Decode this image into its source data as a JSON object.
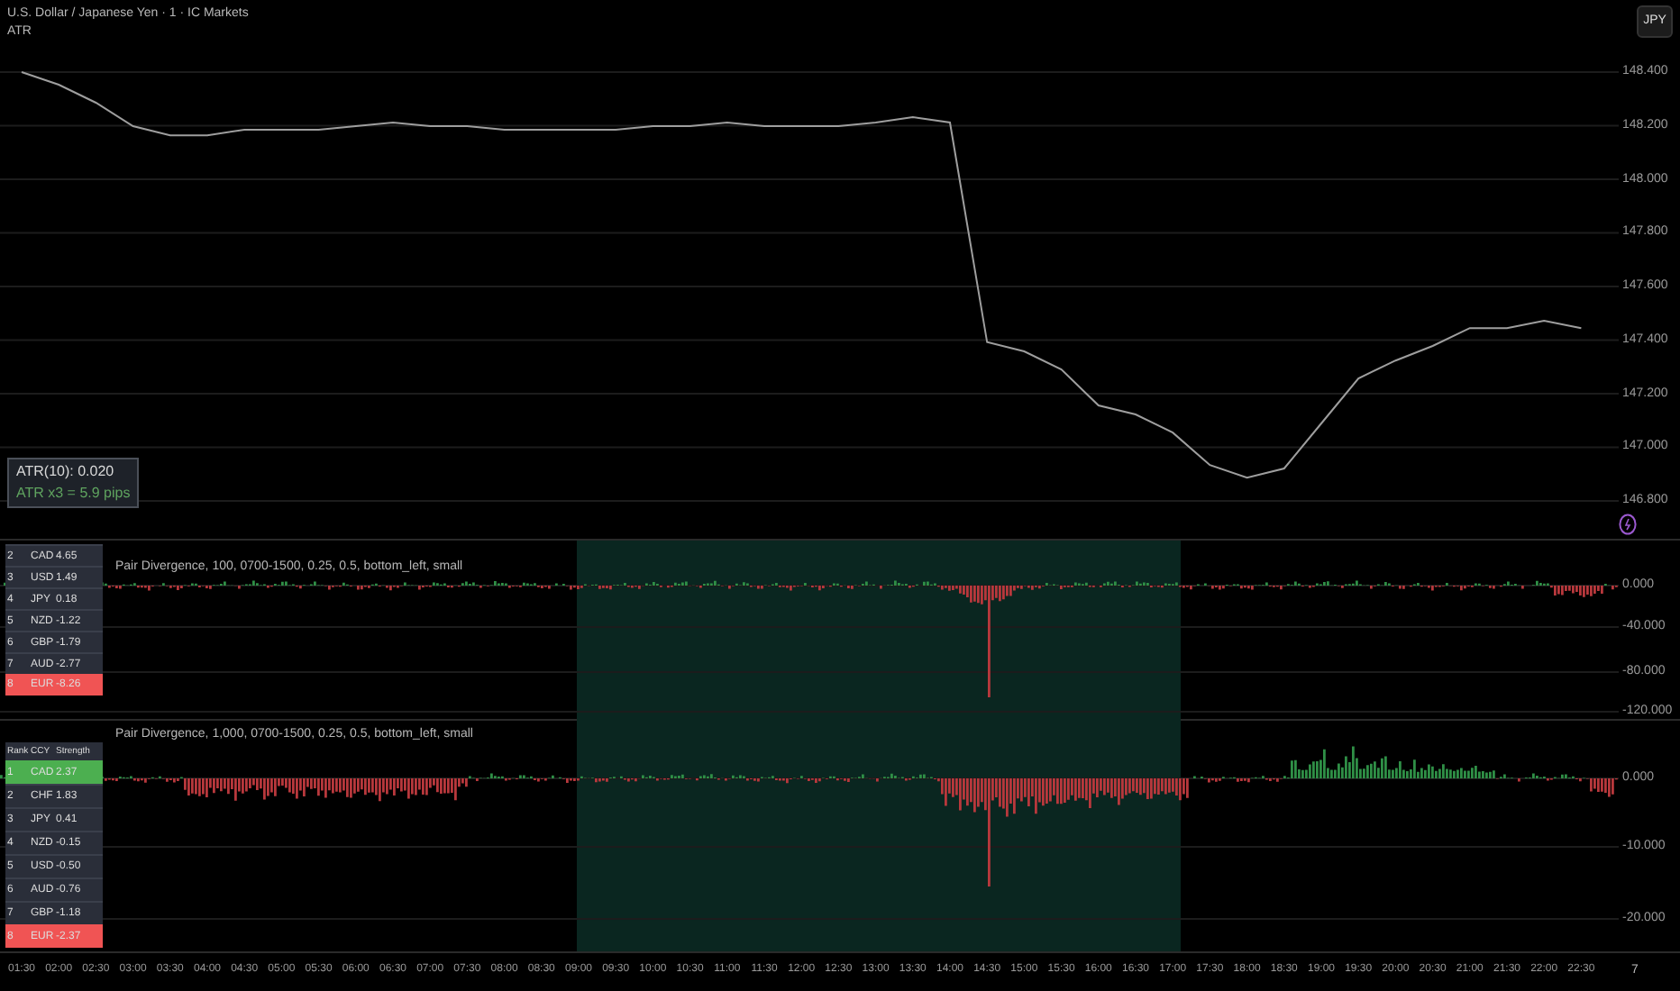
{
  "header": {
    "symbol_title": "U.S. Dollar / Japanese Yen · 1 · IC Markets",
    "indicator_label": "ATR"
  },
  "currency_button": {
    "label": "JPY"
  },
  "atr_box": {
    "line_1": "ATR(10): 0.020",
    "line_2": "ATR x3 = 5.9 pips"
  },
  "time_axis": [
    "01:30",
    "02:00",
    "02:30",
    "03:00",
    "03:30",
    "04:00",
    "04:30",
    "05:00",
    "05:30",
    "06:00",
    "06:30",
    "07:00",
    "07:30",
    "08:00",
    "08:30",
    "09:00",
    "09:30",
    "10:00",
    "10:30",
    "11:00",
    "11:30",
    "12:00",
    "12:30",
    "13:00",
    "13:30",
    "14:00",
    "14:30",
    "15:00",
    "15:30",
    "16:00",
    "16:30",
    "17:00",
    "17:30",
    "18:00",
    "18:30",
    "19:00",
    "19:30",
    "20:00",
    "20:30",
    "21:00",
    "21:30",
    "22:00",
    "22:30"
  ],
  "price_chart": {
    "chart_data": {
      "type": "line",
      "series": [
        {
          "color": "#9e9e9e",
          "values": [
            148.4,
            148.353,
            148.286,
            148.198,
            148.164,
            148.164,
            148.185,
            148.185,
            148.185,
            148.198,
            148.212,
            148.198,
            148.198,
            148.185,
            148.185,
            148.185,
            148.185,
            148.198,
            148.198,
            148.212,
            148.198,
            148.198,
            148.198,
            148.212,
            148.232,
            148.212,
            147.392,
            147.358,
            147.291,
            147.156,
            147.123,
            147.055,
            146.934,
            146.887,
            146.921,
            147.089,
            147.257,
            147.324,
            147.378,
            147.445,
            147.445,
            147.472,
            147.445
          ]
        }
      ],
      "ylim": [
        146.8,
        148.4
      ],
      "grid": true,
      "yticks": [
        {
          "value": 148.4,
          "label": "148.400"
        },
        {
          "value": 148.2,
          "label": "148.200"
        },
        {
          "value": 148.0,
          "label": "148.000"
        },
        {
          "value": 147.8,
          "label": "147.800"
        },
        {
          "value": 147.6,
          "label": "147.600"
        },
        {
          "value": 147.4,
          "label": "147.400"
        },
        {
          "value": 147.2,
          "label": "147.200"
        },
        {
          "value": 147.0,
          "label": "147.000"
        },
        {
          "value": 146.8,
          "label": "146.800"
        }
      ]
    }
  },
  "date_marker": "7",
  "panes": [
    {
      "legend": "Pair Divergence, 100, 0700-1500, 0.25, 0.5, bottom_left, small",
      "axis_labels": [
        "0.000",
        "-40.000",
        "-80.000",
        "-120.000"
      ],
      "table": {
        "rows": [
          {
            "rank": "2",
            "ccy": "CAD",
            "strength": "4.65"
          },
          {
            "rank": "3",
            "ccy": "USD",
            "strength": "1.49"
          },
          {
            "rank": "4",
            "ccy": "JPY",
            "strength": "0.18"
          },
          {
            "rank": "5",
            "ccy": "NZD",
            "strength": "-1.22"
          },
          {
            "rank": "6",
            "ccy": "GBP",
            "strength": "-1.79"
          },
          {
            "rank": "7",
            "ccy": "AUD",
            "strength": "-2.77"
          },
          {
            "rank": "8",
            "ccy": "EUR",
            "strength": "-8.26",
            "color": "#f05454"
          }
        ]
      }
    },
    {
      "legend": "Pair Divergence, 1,000, 0700-1500, 0.25, 0.5, bottom_left, small",
      "axis_labels": [
        "0.000",
        "-10.000",
        "-20.000"
      ],
      "table": {
        "columns": [
          "Rank",
          "CCY",
          "Strength"
        ],
        "rows": [
          {
            "rank": "1",
            "ccy": "CAD",
            "strength": "2.37",
            "color": "#4caf50"
          },
          {
            "rank": "2",
            "ccy": "CHF",
            "strength": "1.83"
          },
          {
            "rank": "3",
            "ccy": "JPY",
            "strength": "0.41"
          },
          {
            "rank": "4",
            "ccy": "NZD",
            "strength": "-0.15"
          },
          {
            "rank": "5",
            "ccy": "USD",
            "strength": "-0.50"
          },
          {
            "rank": "6",
            "ccy": "AUD",
            "strength": "-0.76"
          },
          {
            "rank": "7",
            "ccy": "GBP",
            "strength": "-1.18"
          },
          {
            "rank": "8",
            "ccy": "EUR",
            "strength": "-2.37",
            "color": "#f05454"
          }
        ]
      }
    }
  ]
}
